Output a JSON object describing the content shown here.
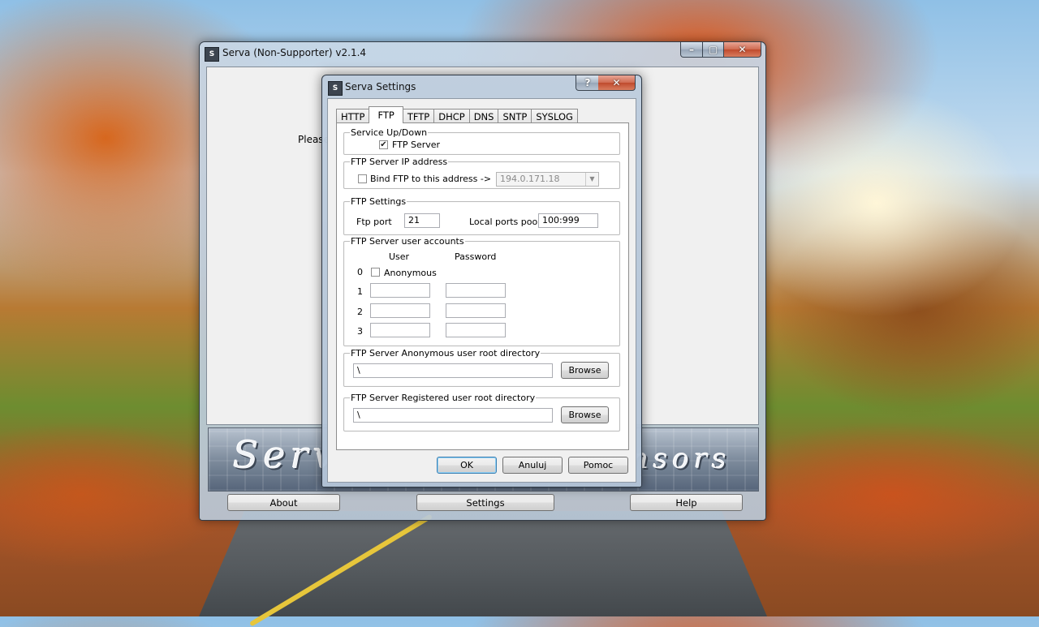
{
  "main_window": {
    "title": "Serva (Non-Supporter) v2.1.4",
    "icon_text": "S",
    "please_text": "Please",
    "banner_left": "Serv",
    "banner_right": "nsors",
    "buttons": {
      "about": "About",
      "settings": "Settings",
      "help": "Help"
    }
  },
  "dialog": {
    "title": "Serva Settings",
    "icon_text": "S",
    "help_btn": "?",
    "close_btn": "✕",
    "tabs": [
      "HTTP",
      "FTP",
      "TFTP",
      "DHCP",
      "DNS",
      "SNTP",
      "SYSLOG"
    ],
    "active_tab": "FTP",
    "service_group": {
      "label": "Service Up/Down",
      "ftp_server_label": "FTP Server",
      "ftp_server_checked": true
    },
    "ip_group": {
      "label": "FTP Server IP address",
      "bind_label": "Bind FTP to this address  ->",
      "bind_checked": false,
      "address": "194.0.171.18"
    },
    "settings_group": {
      "label": "FTP Settings",
      "port_label": "Ftp port",
      "port_value": "21",
      "pool_label": "Local ports pool",
      "pool_value": "100:999"
    },
    "accounts_group": {
      "label": "FTP Server user accounts",
      "user_header": "User",
      "password_header": "Password",
      "rows": [
        {
          "index": "0",
          "anonymous_label": "Anonymous",
          "anonymous_checked": false
        },
        {
          "index": "1",
          "user": "",
          "password": ""
        },
        {
          "index": "2",
          "user": "",
          "password": ""
        },
        {
          "index": "3",
          "user": "",
          "password": ""
        }
      ]
    },
    "anon_dir_group": {
      "label": "FTP Server Anonymous user root directory",
      "path": "\\",
      "browse": "Browse"
    },
    "reg_dir_group": {
      "label": "FTP Server Registered user root directory",
      "path": "\\",
      "browse": "Browse"
    },
    "buttons": {
      "ok": "OK",
      "cancel": "Anuluj",
      "help": "Pomoc"
    }
  },
  "colors": {
    "accent": "#3c7fb1",
    "close_red": "#cf6a50"
  }
}
